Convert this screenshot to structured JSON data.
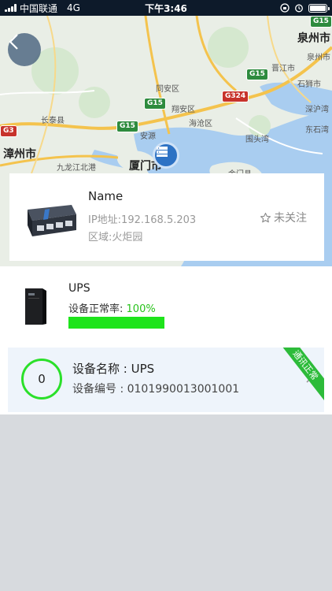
{
  "status_bar": {
    "carrier": "中国联通",
    "network": "4G",
    "time": "下午3:46",
    "icons": [
      "signal-icon",
      "lock-rotation-icon",
      "alarm-icon",
      "battery-icon"
    ]
  },
  "map": {
    "labels": {
      "quanzhou": "泉州市",
      "quanzhou_sub": "泉州市",
      "jinjiang": "晋江市",
      "shishi": "石狮市",
      "shenhu": "深沪湾",
      "dongshi": "东石湾",
      "tongan": "同安区",
      "haicang": "海沧区",
      "xiangan": "翔安区",
      "xiamen": "厦门市",
      "zhangzhou": "漳州市",
      "longhai": "九龙江北港",
      "changtai": "长泰县",
      "weitou": "围头湾",
      "jinmen": "金门县",
      "yuanyi": "安源"
    },
    "shields": [
      "G15",
      "G15",
      "G15",
      "G324",
      "G15",
      "G3"
    ]
  },
  "back_button": {
    "icon": "chevron-left-icon"
  },
  "info_card": {
    "name": "Name",
    "ip": "IP地址:192.168.5.203",
    "area": "区域:火炬园",
    "follow_label": "未关注"
  },
  "device": {
    "title": "UPS",
    "rate_label": "设备正常率:",
    "rate_value": "100%",
    "rate_fraction": 1.0
  },
  "device_card": {
    "count": "0",
    "name": "设备名称 : UPS",
    "code": "设备编号 : 0101990013001001",
    "ribbon": "通讯正常"
  },
  "colors": {
    "accent_green": "#1ee41b",
    "ribbon_green": "#2dbb3a",
    "marker_blue": "#2d72c4"
  }
}
